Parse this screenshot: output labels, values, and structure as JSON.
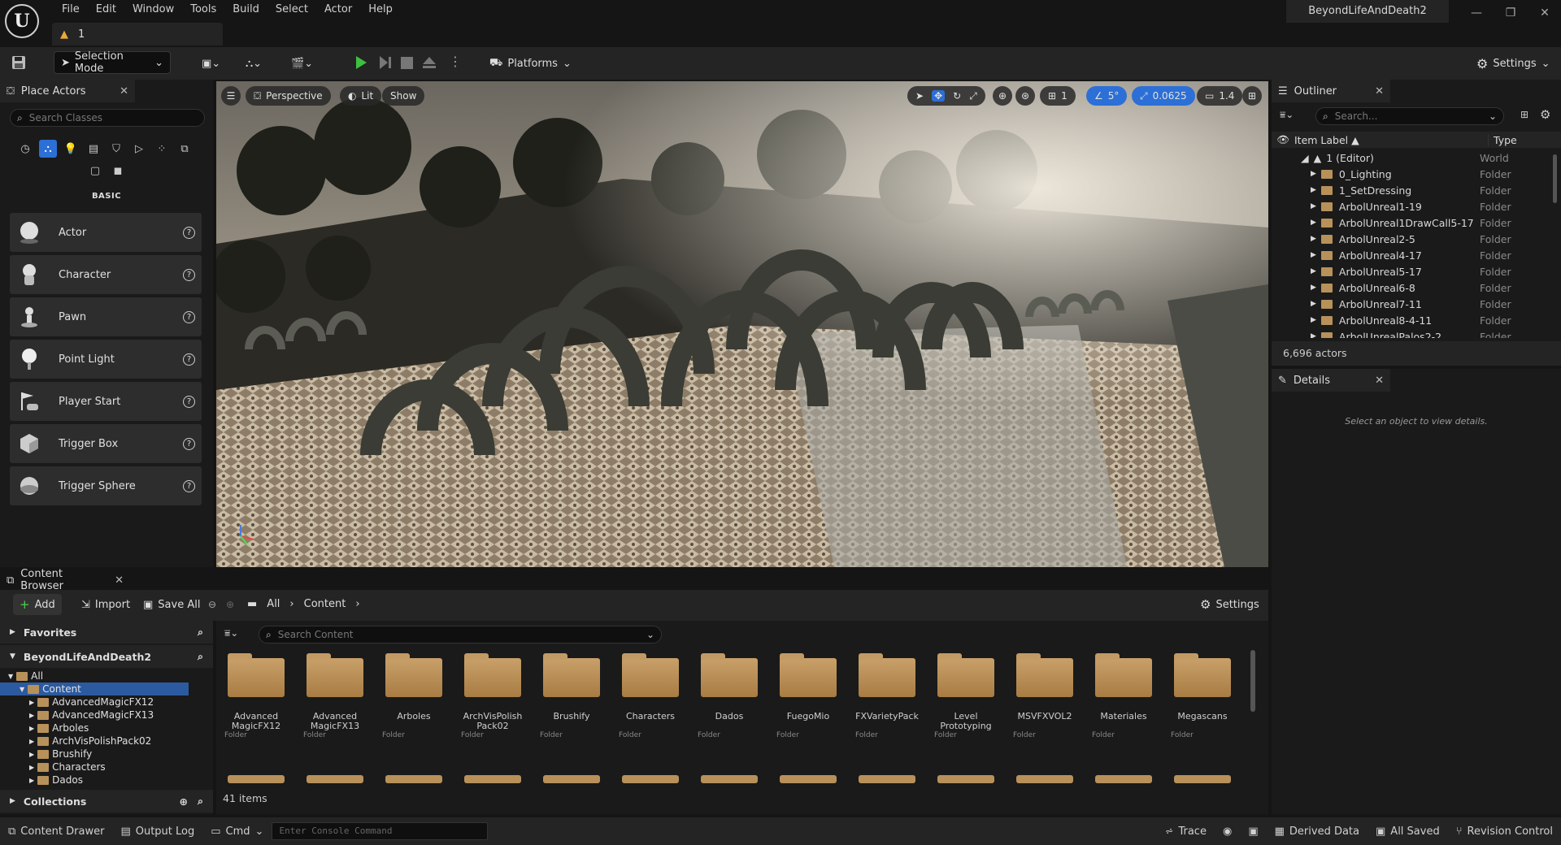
{
  "menu": [
    "File",
    "Edit",
    "Window",
    "Tools",
    "Build",
    "Select",
    "Actor",
    "Help"
  ],
  "level_tab": {
    "label": "1"
  },
  "project_title": "BeyondLifeAndDeath2",
  "toolbar": {
    "selection_mode": "Selection Mode",
    "platforms": "Platforms",
    "settings": "Settings"
  },
  "place_actors": {
    "tab": "Place Actors",
    "search_placeholder": "Search Classes",
    "section": "BASIC",
    "items": [
      "Actor",
      "Character",
      "Pawn",
      "Point Light",
      "Player Start",
      "Trigger Box",
      "Trigger Sphere"
    ]
  },
  "viewport": {
    "perspective": "Perspective",
    "lit": "Lit",
    "show": "Show",
    "grid": "1",
    "angle": "5°",
    "scale": "0.0625",
    "camera": "1.4"
  },
  "outliner": {
    "tab": "Outliner",
    "search_placeholder": "Search...",
    "col_label": "Item Label",
    "col_type": "Type",
    "rows": [
      {
        "name": "1 (Editor)",
        "type": "World"
      },
      {
        "name": "0_Lighting",
        "type": "Folder"
      },
      {
        "name": "1_SetDressing",
        "type": "Folder"
      },
      {
        "name": "ArbolUnreal1-19",
        "type": "Folder"
      },
      {
        "name": "ArbolUnreal1DrawCall5-17",
        "type": "Folder"
      },
      {
        "name": "ArbolUnreal2-5",
        "type": "Folder"
      },
      {
        "name": "ArbolUnreal4-17",
        "type": "Folder"
      },
      {
        "name": "ArbolUnreal5-17",
        "type": "Folder"
      },
      {
        "name": "ArbolUnreal6-8",
        "type": "Folder"
      },
      {
        "name": "ArbolUnreal7-11",
        "type": "Folder"
      },
      {
        "name": "ArbolUnreal8-4-11",
        "type": "Folder"
      },
      {
        "name": "ArbolUnrealPalos2-2",
        "type": "Folder"
      }
    ],
    "count": "6,696 actors"
  },
  "details": {
    "tab": "Details",
    "empty": "Select an object to view details."
  },
  "content_browser": {
    "tab": "Content Browser",
    "add": "Add",
    "import": "Import",
    "save_all": "Save All",
    "path": [
      "All",
      "Content"
    ],
    "settings": "Settings",
    "favorites": "Favorites",
    "project": "BeyondLifeAndDeath2",
    "tree": [
      "All",
      "Content",
      "AdvancedMagicFX12",
      "AdvancedMagicFX13",
      "Arboles",
      "ArchVisPolishPack02",
      "Brushify",
      "Characters",
      "Dados"
    ],
    "collections": "Collections",
    "search_placeholder": "Search Content",
    "folders": [
      {
        "name": "Advanced MagicFX12",
        "type": "Folder"
      },
      {
        "name": "Advanced MagicFX13",
        "type": "Folder"
      },
      {
        "name": "Arboles",
        "type": "Folder"
      },
      {
        "name": "ArchVisPolish Pack02",
        "type": "Folder"
      },
      {
        "name": "Brushify",
        "type": "Folder"
      },
      {
        "name": "Characters",
        "type": "Folder"
      },
      {
        "name": "Dados",
        "type": "Folder"
      },
      {
        "name": "FuegoMio",
        "type": "Folder"
      },
      {
        "name": "FXVarietyPack",
        "type": "Folder"
      },
      {
        "name": "Level Prototyping",
        "type": "Folder"
      },
      {
        "name": "MSVFXVOL2",
        "type": "Folder"
      },
      {
        "name": "Materiales",
        "type": "Folder"
      },
      {
        "name": "Megascans",
        "type": "Folder"
      }
    ],
    "item_count": "41 items"
  },
  "statusbar": {
    "content_drawer": "Content Drawer",
    "output_log": "Output Log",
    "cmd": "Cmd",
    "console_placeholder": "Enter Console Command",
    "trace": "Trace",
    "derived_data": "Derived Data",
    "all_saved": "All Saved",
    "revision_control": "Revision Control"
  },
  "colors": {
    "accent": "#2c6fd6",
    "play": "#3fbf3f",
    "folder": "#b8915a",
    "panel": "#242424",
    "background": "#151515"
  }
}
